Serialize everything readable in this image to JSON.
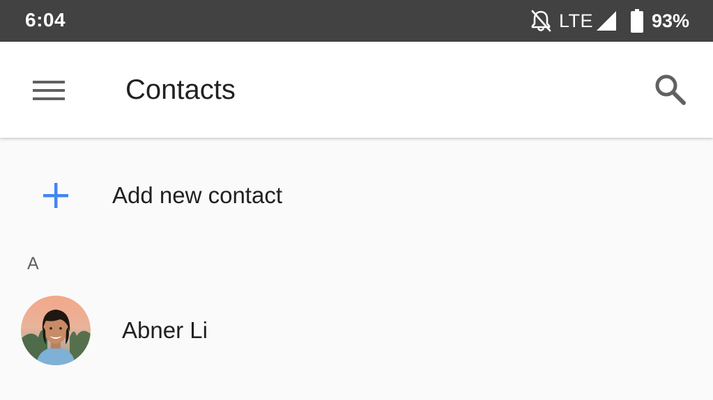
{
  "status_bar": {
    "time": "6:04",
    "network": "LTE",
    "battery": "93%",
    "icons": [
      "notifications-off-icon",
      "signal-icon",
      "battery-icon"
    ]
  },
  "app_bar": {
    "title": "Contacts",
    "icons": [
      "menu-icon",
      "search-icon"
    ]
  },
  "add_contact": {
    "label": "Add new contact",
    "icon": "plus-icon",
    "icon_color": "#4285f4"
  },
  "contacts": {
    "sections": [
      {
        "letter": "A",
        "items": [
          {
            "name": "Abner Li",
            "avatar": "photo"
          }
        ]
      }
    ]
  },
  "colors": {
    "status_bar": "#424242",
    "app_bar": "#ffffff",
    "background": "#fafafa",
    "accent": "#4285f4"
  }
}
